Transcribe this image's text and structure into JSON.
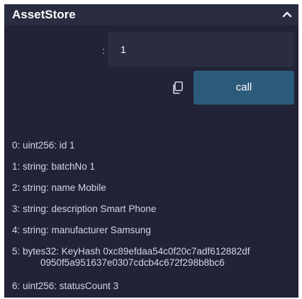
{
  "panel": {
    "title": "AssetStore",
    "collapse_icon": "chevron-up-icon"
  },
  "input": {
    "colon": ":",
    "value": "1"
  },
  "actions": {
    "copy_icon": "copy-icon",
    "call_label": "call"
  },
  "outputs": [
    "0: uint256: id 1",
    "1: string: batchNo 1",
    "2: string: name Mobile",
    "3: string: description Smart Phone",
    "4: string: manufacturer Samsung",
    "5:  bytes32: KeyHash 0xc89efdaa54c0f20c7adf612882df",
    "6: uint256: statusCount 3"
  ],
  "output_hash_continuation": "0950f5a951637e0307cdcb4c672f298b8bc6",
  "colors": {
    "panel_bg": "#222336",
    "header_bg": "#2a2c3f",
    "input_bg": "#2a2c3f",
    "button_bg": "#2c5a7a",
    "text": "#d4d6e0"
  }
}
